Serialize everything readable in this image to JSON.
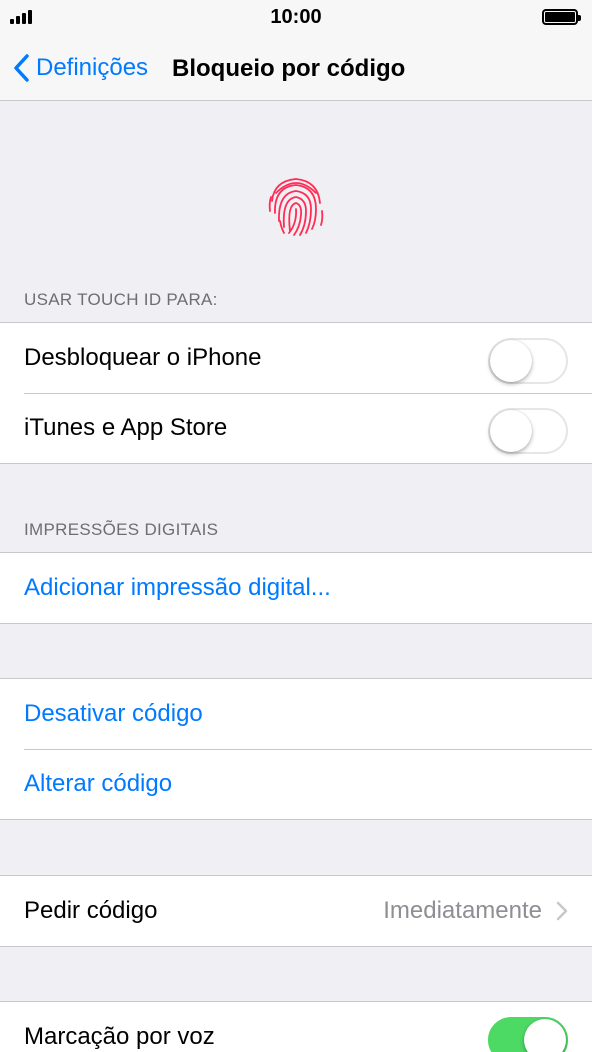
{
  "status_bar": {
    "time": "10:00"
  },
  "nav": {
    "back_label": "Definições",
    "title": "Bloqueio por código"
  },
  "touch_id_section": {
    "header": "USAR TOUCH ID PARA:",
    "rows": [
      {
        "label": "Desbloquear o iPhone",
        "toggle_on": false
      },
      {
        "label": "iTunes e App Store",
        "toggle_on": false
      }
    ]
  },
  "fingerprints_section": {
    "header": "IMPRESSÕES DIGITAIS",
    "add_label": "Adicionar impressão digital..."
  },
  "passcode_section": {
    "disable_label": "Desativar código",
    "change_label": "Alterar código"
  },
  "require_section": {
    "label": "Pedir código",
    "value": "Imediatamente"
  },
  "voice_dial_section": {
    "label": "Marcação por voz",
    "toggle_on": true
  },
  "colors": {
    "accent": "#007aff",
    "fingerprint": "#ff2d55",
    "toggle_on": "#4cd964",
    "background": "#efeff4"
  }
}
